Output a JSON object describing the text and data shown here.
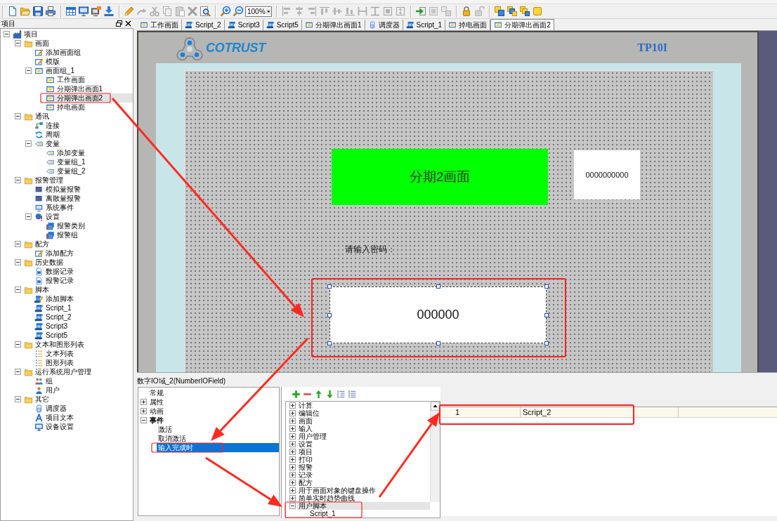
{
  "toolbar": [
    [
      {
        "kind": "new",
        "disabled": false
      },
      {
        "kind": "open",
        "disabled": false
      },
      {
        "kind": "save",
        "disabled": false
      },
      {
        "kind": "print",
        "disabled": false
      }
    ],
    [
      {
        "kind": "grid",
        "disabled": false
      },
      {
        "kind": "monitor",
        "disabled": false
      },
      {
        "kind": "export",
        "disabled": false
      },
      {
        "kind": "download",
        "disabled": false
      }
    ],
    [
      {
        "kind": "pencil",
        "disabled": false
      },
      {
        "kind": "redo",
        "disabled": true
      },
      {
        "kind": "cut",
        "disabled": true
      },
      {
        "kind": "copy",
        "disabled": true
      },
      {
        "kind": "paste",
        "disabled": true
      },
      {
        "kind": "delete",
        "disabled": true
      },
      {
        "kind": "find",
        "disabled": false
      }
    ],
    [
      {
        "kind": "zoom-in",
        "disabled": false
      },
      {
        "kind": "zoom-out",
        "disabled": false
      },
      {
        "kind": "combo",
        "value": "100%"
      }
    ],
    [
      {
        "kind": "align-left",
        "disabled": true
      },
      {
        "kind": "align-center",
        "disabled": true
      },
      {
        "kind": "align-right",
        "disabled": true
      },
      {
        "kind": "align-top",
        "disabled": true
      },
      {
        "kind": "align-middle",
        "disabled": true
      },
      {
        "kind": "align-bottom",
        "disabled": true
      },
      {
        "kind": "same-width",
        "disabled": true
      },
      {
        "kind": "same-height",
        "disabled": true
      },
      {
        "kind": "same-size",
        "disabled": true
      },
      {
        "kind": "center-both",
        "disabled": true
      }
    ],
    [
      {
        "kind": "import",
        "disabled": false
      },
      {
        "kind": "group",
        "disabled": true
      },
      {
        "kind": "ungroup",
        "disabled": true
      }
    ],
    [
      {
        "kind": "lock",
        "disabled": false
      },
      {
        "kind": "unlock",
        "disabled": true
      }
    ],
    [
      {
        "kind": "front",
        "disabled": false
      },
      {
        "kind": "forward",
        "disabled": false
      },
      {
        "kind": "backward",
        "disabled": false
      },
      {
        "kind": "back",
        "disabled": false
      }
    ]
  ],
  "project_panel": {
    "title": "项目",
    "tree": [
      {
        "label": "项目",
        "kind": "project",
        "expanded": true,
        "selected": false,
        "children": [
          {
            "label": "画面",
            "kind": "folder",
            "expanded": true,
            "selected": false,
            "children": [
              {
                "label": "添加画面组",
                "kind": "edit",
                "selected": false
              },
              {
                "label": "模版",
                "kind": "edit",
                "selected": false
              },
              {
                "label": "画面组_1",
                "kind": "screen",
                "expanded": true,
                "selected": false,
                "children": [
                  {
                    "label": "工作画面",
                    "kind": "screen",
                    "selected": false
                  },
                  {
                    "label": "分期弹出画面1",
                    "kind": "screen",
                    "selected": false
                  },
                  {
                    "label": "分期弹出画面2",
                    "kind": "screen",
                    "selected": true
                  },
                  {
                    "label": "掉电画面",
                    "kind": "screen",
                    "selected": false
                  }
                ]
              }
            ]
          },
          {
            "label": "通讯",
            "kind": "folder",
            "expanded": true,
            "selected": false,
            "children": [
              {
                "label": "连接",
                "kind": "link",
                "selected": false
              },
              {
                "label": "周期",
                "kind": "cycle",
                "selected": false
              },
              {
                "label": "变量",
                "kind": "tag",
                "expanded": true,
                "selected": false,
                "children": [
                  {
                    "label": "添加变量",
                    "kind": "tag",
                    "selected": false
                  },
                  {
                    "label": "变量组_1",
                    "kind": "tag",
                    "selected": false
                  },
                  {
                    "label": "变量组_2",
                    "kind": "tag",
                    "selected": false
                  }
                ]
              }
            ]
          },
          {
            "label": "报警管理",
            "kind": "folder",
            "expanded": true,
            "selected": false,
            "children": [
              {
                "label": "模拟量报警",
                "kind": "chart",
                "selected": false
              },
              {
                "label": "离散量报警",
                "kind": "chart",
                "selected": false
              },
              {
                "label": "系统事件",
                "kind": "event",
                "selected": false
              },
              {
                "label": "设置",
                "kind": "alert",
                "expanded": true,
                "selected": false,
                "children": [
                  {
                    "label": "报警类别",
                    "kind": "alert-window",
                    "selected": false
                  },
                  {
                    "label": "报警组",
                    "kind": "alert-window",
                    "selected": false
                  }
                ]
              }
            ]
          },
          {
            "label": "配方",
            "kind": "folder",
            "expanded": true,
            "selected": false,
            "children": [
              {
                "label": "添加配方",
                "kind": "edit",
                "selected": false
              }
            ]
          },
          {
            "label": "历史数据",
            "kind": "folder",
            "expanded": true,
            "selected": false,
            "children": [
              {
                "label": "数据记录",
                "kind": "log",
                "selected": false
              },
              {
                "label": "报警记录",
                "kind": "log",
                "selected": false
              }
            ]
          },
          {
            "label": "脚本",
            "kind": "folder",
            "expanded": true,
            "selected": false,
            "children": [
              {
                "label": "添加脚本",
                "kind": "script-add",
                "selected": false
              },
              {
                "label": "Script_1",
                "kind": "script",
                "selected": false
              },
              {
                "label": "Script_2",
                "kind": "script",
                "selected": false
              },
              {
                "label": "Script3",
                "kind": "script",
                "selected": false
              },
              {
                "label": "Script5",
                "kind": "script",
                "selected": false
              }
            ]
          },
          {
            "label": "文本和图形列表",
            "kind": "folder",
            "expanded": true,
            "selected": false,
            "children": [
              {
                "label": "文本列表",
                "kind": "list",
                "selected": false
              },
              {
                "label": "图形列表",
                "kind": "list",
                "selected": false
              }
            ]
          },
          {
            "label": "运行系统用户管理",
            "kind": "folder",
            "expanded": true,
            "selected": false,
            "children": [
              {
                "label": "组",
                "kind": "users",
                "selected": false
              },
              {
                "label": "用户",
                "kind": "user",
                "selected": false
              }
            ]
          },
          {
            "label": "其它",
            "kind": "folder",
            "expanded": true,
            "selected": false,
            "children": [
              {
                "label": "调度器",
                "kind": "scheduler",
                "selected": false
              },
              {
                "label": "项目文本",
                "kind": "text",
                "selected": false
              },
              {
                "label": "设备设置",
                "kind": "device",
                "selected": false
              }
            ]
          }
        ]
      }
    ]
  },
  "tabs": [
    {
      "label": "工作画面",
      "kind": "screen",
      "selected": false
    },
    {
      "label": "Script_2",
      "kind": "script",
      "selected": false
    },
    {
      "label": "Script3",
      "kind": "script",
      "selected": false
    },
    {
      "label": "Script5",
      "kind": "script",
      "selected": false
    },
    {
      "label": "分期弹出画面1",
      "kind": "screen",
      "selected": false
    },
    {
      "label": "调度器",
      "kind": "scheduler",
      "selected": false
    },
    {
      "label": "Script_1",
      "kind": "script",
      "selected": false
    },
    {
      "label": "掉电画面",
      "kind": "screen",
      "selected": false
    },
    {
      "label": "分期弹出画面2",
      "kind": "screen",
      "selected": true
    }
  ],
  "screen": {
    "logo": "COTRUST",
    "device": "TP10I",
    "objects": [
      {
        "kind": "rectangle",
        "text": "分期2画面",
        "selected": false
      },
      {
        "kind": "io-field",
        "text": "0000000000",
        "selected": false
      },
      {
        "kind": "text",
        "text": "请输入密码：",
        "selected": false
      },
      {
        "kind": "io-field",
        "text": "000000",
        "selected": true
      }
    ]
  },
  "properties": {
    "title": "数字IO域_2(NumberIOField)",
    "categories": [
      {
        "label": "常规",
        "selected": false,
        "emphasized": false
      },
      {
        "label": "属性",
        "expanded": false,
        "selected": false,
        "emphasized": false
      },
      {
        "label": "动画",
        "expanded": false,
        "selected": false,
        "emphasized": false
      },
      {
        "label": "事件",
        "expanded": true,
        "selected": false,
        "emphasized": true,
        "children": [
          {
            "label": "激活",
            "selected": false
          },
          {
            "label": "取消激活",
            "selected": false
          },
          {
            "label": "输入完成时",
            "selected": true
          }
        ]
      }
    ]
  },
  "functions": {
    "toolbar": [
      {
        "kind": "add"
      },
      {
        "kind": "remove"
      },
      {
        "kind": "up"
      },
      {
        "kind": "down"
      },
      {
        "kind": "indent"
      },
      {
        "kind": "outdent"
      }
    ],
    "items": [
      {
        "label": "计算",
        "expanded": false,
        "selected": false
      },
      {
        "label": "编辑位",
        "expanded": false,
        "selected": false
      },
      {
        "label": "画面",
        "expanded": false,
        "selected": false
      },
      {
        "label": "输入",
        "expanded": false,
        "selected": false
      },
      {
        "label": "用户管理",
        "expanded": false,
        "selected": false
      },
      {
        "label": "设置",
        "expanded": false,
        "selected": false
      },
      {
        "label": "项目",
        "expanded": false,
        "selected": false
      },
      {
        "label": "打印",
        "expanded": false,
        "selected": false
      },
      {
        "label": "报警",
        "expanded": false,
        "selected": false
      },
      {
        "label": "记录",
        "expanded": false,
        "selected": false
      },
      {
        "label": "配方",
        "expanded": false,
        "selected": false
      },
      {
        "label": "用于画面对象的键盘操作",
        "expanded": false,
        "selected": false
      },
      {
        "label": "简单实时趋势曲线",
        "expanded": false,
        "selected": false
      },
      {
        "label": "用户脚本",
        "expanded": true,
        "selected": true,
        "children": [
          {
            "label": "Script_1",
            "selected": false
          }
        ]
      }
    ]
  },
  "script_table": {
    "rows": [
      [
        "1",
        "Script_2"
      ]
    ]
  }
}
